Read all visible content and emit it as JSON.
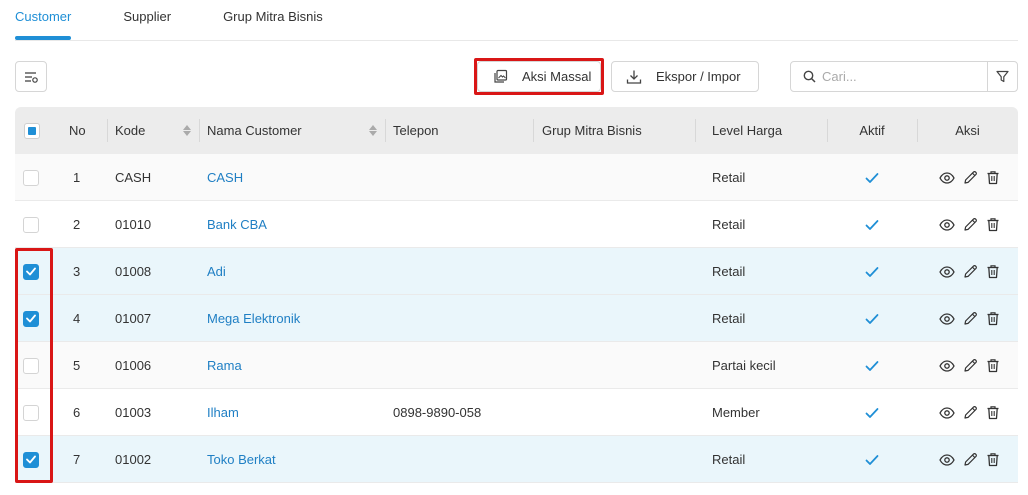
{
  "tabs": [
    {
      "label": "Customer",
      "active": true
    },
    {
      "label": "Supplier",
      "active": false
    },
    {
      "label": "Grup Mitra Bisnis",
      "active": false
    }
  ],
  "toolbar": {
    "bulk_action_label": "Aksi Massal",
    "export_import_label": "Ekspor / Impor",
    "search_placeholder": "Cari...",
    "search_value": ""
  },
  "table": {
    "columns": {
      "no": "No",
      "kode": "Kode",
      "nama": "Nama Customer",
      "telepon": "Telepon",
      "grup": "Grup Mitra Bisnis",
      "level": "Level Harga",
      "aktif": "Aktif",
      "aksi": "Aksi"
    },
    "rows": [
      {
        "checked": false,
        "no": "1",
        "kode": "CASH",
        "nama": "CASH",
        "telepon": "",
        "grup": "",
        "level": "Retail",
        "aktif": true
      },
      {
        "checked": false,
        "no": "2",
        "kode": "01010",
        "nama": "Bank CBA",
        "telepon": "",
        "grup": "",
        "level": "Retail",
        "aktif": true
      },
      {
        "checked": true,
        "no": "3",
        "kode": "01008",
        "nama": "Adi",
        "telepon": "",
        "grup": "",
        "level": "Retail",
        "aktif": true
      },
      {
        "checked": true,
        "no": "4",
        "kode": "01007",
        "nama": "Mega Elektronik",
        "telepon": "",
        "grup": "",
        "level": "Retail",
        "aktif": true
      },
      {
        "checked": false,
        "no": "5",
        "kode": "01006",
        "nama": "Rama",
        "telepon": "",
        "grup": "",
        "level": "Partai kecil",
        "aktif": true
      },
      {
        "checked": false,
        "no": "6",
        "kode": "01003",
        "nama": "Ilham",
        "telepon": "0898-9890-058",
        "grup": "",
        "level": "Member",
        "aktif": true
      },
      {
        "checked": true,
        "no": "7",
        "kode": "01002",
        "nama": "Toko Berkat",
        "telepon": "",
        "grup": "",
        "level": "Retail",
        "aktif": true
      }
    ]
  },
  "colors": {
    "accent": "#1f8fd6",
    "link": "#1f7fc4",
    "highlight": "#d91616",
    "selected_row": "#eaf6fb"
  }
}
